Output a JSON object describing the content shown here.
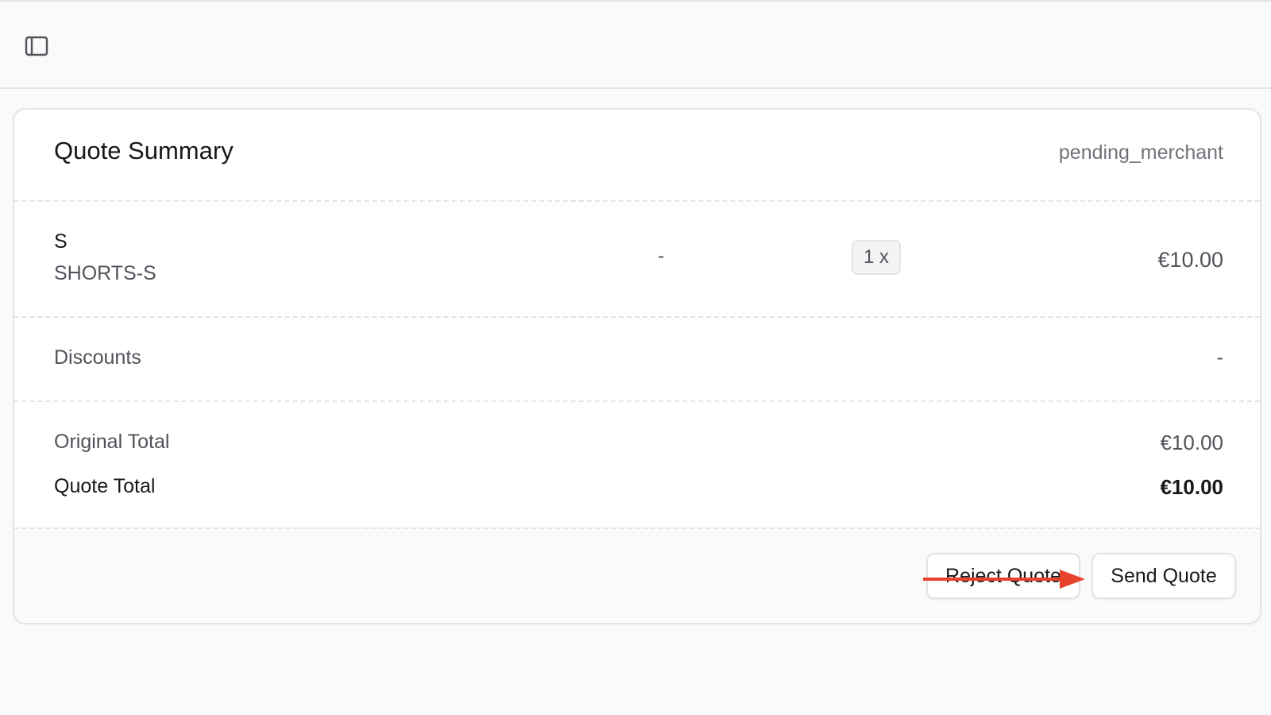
{
  "header": {
    "toggle_icon": "sidebar-panel-icon"
  },
  "quote": {
    "title": "Quote Summary",
    "status": "pending_merchant",
    "items": [
      {
        "title": "S",
        "sku": "SHORTS-S",
        "unit_price": "-",
        "quantity": "1 x",
        "total": "€10.00"
      }
    ],
    "discounts": {
      "label": "Discounts",
      "value": "-"
    },
    "original_total": {
      "label": "Original Total",
      "value": "€10.00"
    },
    "quote_total": {
      "label": "Quote Total",
      "value": "€10.00"
    },
    "actions": {
      "reject_label": "Reject Quote",
      "send_label": "Send Quote"
    }
  },
  "annotation": {
    "arrow_color": "#e8412c"
  }
}
